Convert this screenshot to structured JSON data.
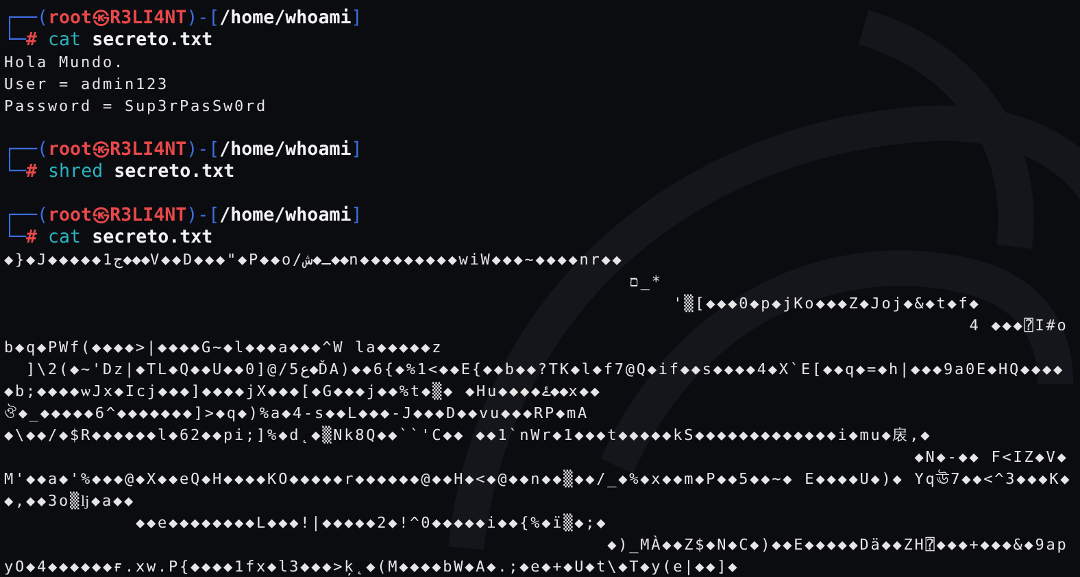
{
  "terminal": {
    "blocks": [
      {
        "prompt": {
          "corner_top": "┌──(",
          "user": "root",
          "symbol": "㉿",
          "host": "R3LI4NT",
          "separator": ")-[",
          "path": "/home/whoami",
          "close": "]",
          "corner_bottom": "└─",
          "mark": "#"
        },
        "command": "cat",
        "args": "secreto.txt",
        "output": [
          "Hola Mundo.",
          "User = admin123",
          "Password = Sup3rPasSw0rd"
        ]
      },
      {
        "prompt": {
          "corner_top": "┌──(",
          "user": "root",
          "symbol": "㉿",
          "host": "R3LI4NT",
          "separator": ")-[",
          "path": "/home/whoami",
          "close": "]",
          "corner_bottom": "└─",
          "mark": "#"
        },
        "command": "shred",
        "args": "secreto.txt"
      },
      {
        "prompt": {
          "corner_top": "┌──(",
          "user": "root",
          "symbol": "㉿",
          "host": "R3LI4NT",
          "separator": ")-[",
          "path": "/home/whoami",
          "close": "]",
          "corner_bottom": "└─",
          "mark": "#"
        },
        "command": "cat",
        "args": "secreto.txt",
        "output": [
          "◆}◆J◆◆◆◆◆1ج◆◆◆V◆◆D◆◆◆\"◆P◆◆o/ـ◆ش◆◆n◆◆◆◆◆◆◆◆◆wiW◆◆◆~◆◆◆◆nr◆◆",
          "                                                         ם_*",
          "                                                             '▒[◆◆◆0◆p◆jKo◆◆◆Z◆Joj◆&◆t◆f◆",
          "                                                                                        4 ◆◆◆⍰I#o",
          "b◆q◆PWf(◆◆◆◆>|◆◆◆◆G~◆l◆◆◆a◆◆◆^W la◆◆◆◆◆z",
          "  ]\\2(◆~'Dz|◆TL◆Q◆◆U◆◆0]@/5ع◆ĎA)◆◆6{◆%1<◆◆E{◆◆b◆◆?TK◆l◆f7@Q◆if◆◆s◆◆◆◆4◆X`E[◆◆q◆=◆h|◆◆◆9a0E◆HQ◆◆◆◆",
          "◆b;◆◆◆◆ѡJx◆Icj◆◆◆]◆◆◆◆jX◆◆◆[◆G◆◆◆j◆◆%t◆▒◆ ◆Hu◆◆◆◆ۓ◆◆x◆◆",
          "ঔ◆_◆◆◆◆◆6^◆◆◆◆◆◆◆]>◆q◆)%a◆4-s◆◆L◆◆◆-J◆◆◆D◆◆vu◆◆◆RP◆mA",
          "◆\\◆◆/◆$R◆◆◆◆◆◆l◆62◆◆pi;]%◆d˛◆▒Nk8Q◆◆``'C◆◆ ◆◆1`nWr◆1◆◆◆t◆◆◆◆◆kS◆◆◆◆◆◆◆◆◆◆◆◆◆i◆mu◆扆,◆",
          "                                                                                   ◆N◆-◆◆ F<IZ◆V◆",
          "M'◆◆a◆'%◆◆◆@◆X◆◆eQ◆H◆◆◆◆KO◆◆◆◆◆r◆◆◆◆◆◆@◆◆H◆<◆@◆◆n◆◆▒◆◆/_◆%◆x◆◆m◆P◆◆5◆◆~◆ E◆◆◆◆U◆)◆ Yqঊ7◆◆<^3◆◆◆K◆",
          "◆,◆◆3o▒ǉ◆a◆◆",
          "            ◆◆e◆◆◆◆◆◆◆◆L◆◆◆!|◆◆◆◆◆2◆!^0◆◆◆◆◆i◆◆{%◆ï▒◆;◆",
          "                                                       ◆)_MÀ◆◆Z$◆N◆C◆)◆◆E◆◆◆◆◆Dä◆◆ZH⍰◆◆◆+◆◆◆&◆9ap",
          "yO◆4◆◆◆◆◆◆ғ.xw.P{◆◆◆◆1fx◆l3◆◆◆>ķ˛◆(M◆◆◆◆bW◆A◆.;◆e◆+◆U◆t\\◆T◆y(e|◆◆]◆"
        ]
      }
    ]
  }
}
